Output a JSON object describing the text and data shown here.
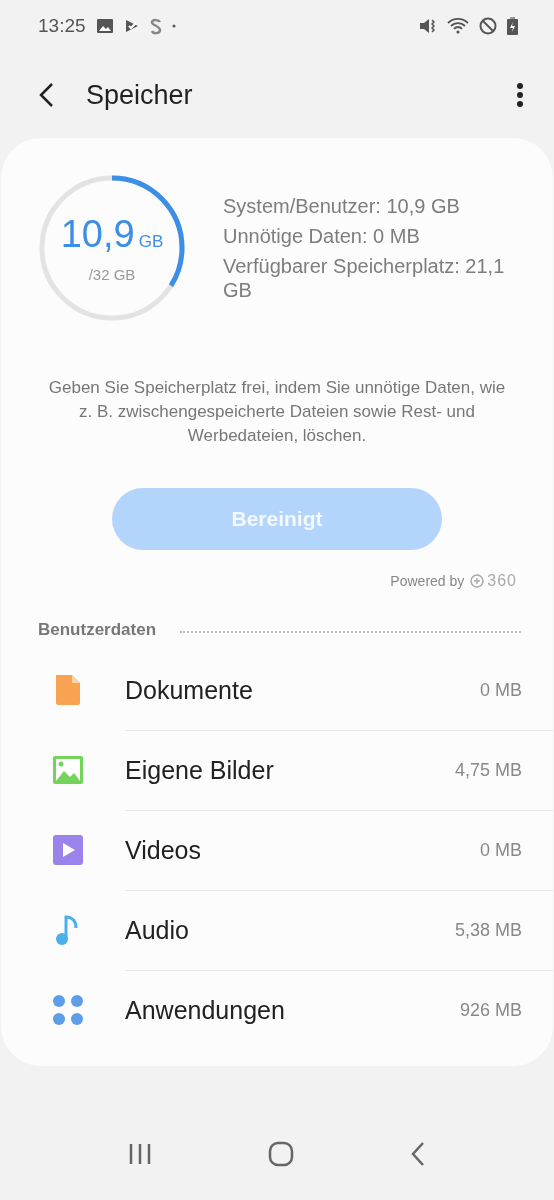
{
  "status_bar": {
    "time": "13:25"
  },
  "header": {
    "title": "Speicher"
  },
  "storage": {
    "used": "10,9",
    "used_unit": "GB",
    "total": "/32 GB",
    "level": 0.34,
    "details": [
      "System/Benutzer: 10,9 GB",
      "Unnötige Daten: 0 MB",
      "Verfügbarer Speicherplatz: 21,1 GB"
    ]
  },
  "description": "Geben Sie Speicherplatz frei, indem Sie unnötige Daten, wie z. B. zwischengespeicherte Dateien sowie Rest- und Werbedateien, löschen.",
  "clean_button": {
    "label": "Bereinigt",
    "disabled": true
  },
  "powered_by": {
    "text": "Powered by",
    "logo": "360"
  },
  "section": {
    "title": "Benutzerdaten"
  },
  "categories": [
    {
      "kind": "document",
      "name": "Dokumente",
      "size": "0 MB"
    },
    {
      "kind": "image",
      "name": "Eigene Bilder",
      "size": "4,75 MB"
    },
    {
      "kind": "video",
      "name": "Videos",
      "size": "0 MB"
    },
    {
      "kind": "audio",
      "name": "Audio",
      "size": "5,38 MB"
    },
    {
      "kind": "apps",
      "name": "Anwendungen",
      "size": "926 MB"
    }
  ]
}
